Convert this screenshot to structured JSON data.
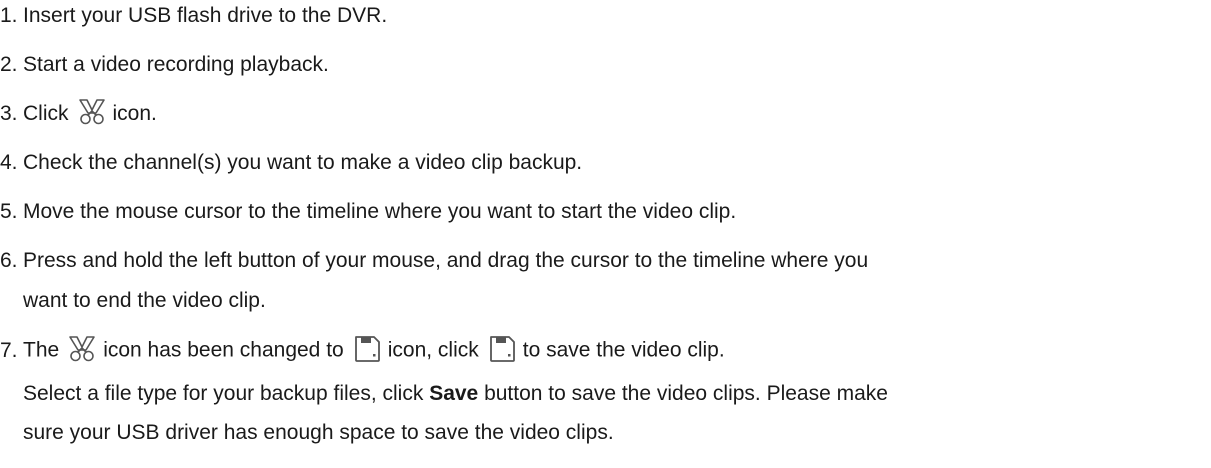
{
  "steps": [
    {
      "num": "1.",
      "text": "Insert your USB flash drive to the DVR."
    },
    {
      "num": "2.",
      "text": "Start a video recording playback."
    },
    {
      "num": "3.",
      "before": "Click",
      "icon": "scissors-clip-icon",
      "after": "icon."
    },
    {
      "num": "4.",
      "text": "Check the channel(s) you want to make a video clip backup."
    },
    {
      "num": "5.",
      "text": "Move the mouse cursor to the timeline where you want to start the video clip."
    },
    {
      "num": "6.",
      "line1": "Press and hold the left button of your mouse, and drag the cursor to the timeline where you",
      "line2": "want to end the video clip."
    },
    {
      "num": "7.",
      "part1": "The",
      "icon1": "scissors-clip-icon",
      "part2": "icon has been changed to",
      "icon2": "save-clip-icon",
      "part3": "icon, click",
      "icon3": "save-clip-icon",
      "part4": "to save the video clip.",
      "note_line1_before": "Select a file type for your backup files, click",
      "note_bold": "Save",
      "note_line1_after": "button to save the video clips. Please make",
      "note_line2": "sure your USB driver has enough space to save the video clips."
    }
  ],
  "colors": {
    "text": "#1a1a1a",
    "icon_stroke": "#555555"
  }
}
